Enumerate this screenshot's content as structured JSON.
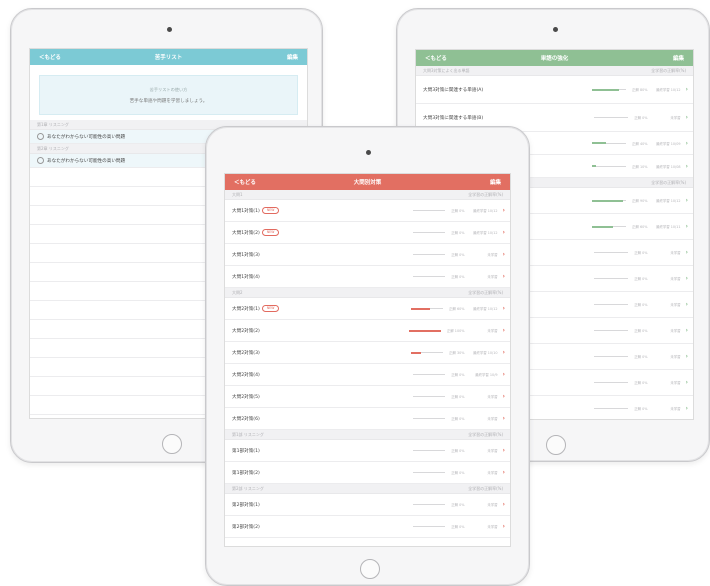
{
  "colors": {
    "blue": "#7ccad5",
    "green": "#8fc094",
    "red": "#e26f62",
    "blue_bg": "#eaf5f9"
  },
  "ipad_left": {
    "nav": {
      "back": "＜もどる",
      "title": "苦手リスト",
      "edit": "編集"
    },
    "notice": {
      "line1": "苦手リストの使い方",
      "line2": "苦手な単語や問題を学習しましょう。"
    },
    "sections": [
      {
        "header": "第1章 リスニング",
        "item": "あなたがわからない可能性の高い問題"
      },
      {
        "header": "第2章 リスニング",
        "item": "あなたがわからない可能性の高い問題"
      }
    ]
  },
  "ipad_right": {
    "nav": {
      "back": "＜もどる",
      "title": "単語の強化",
      "edit": "編集"
    },
    "section1": "大問3対策によく出る単語",
    "section1_right": "全学習の正解率(%)",
    "rows": [
      {
        "label": "大問3対策に関連する単語(A)",
        "meta1": "正解 80%",
        "meta2": "最終学習 10/12",
        "progress": 0.8
      },
      {
        "label": "大問3対策に関連する単語(B)",
        "meta1": "正解 0%",
        "meta2": "未学習",
        "progress": 0.0
      },
      {
        "label": "",
        "meta1": "正解 40%",
        "meta2": "最終学習 10/09",
        "progress": 0.4
      },
      {
        "label": "",
        "meta1": "正解 10%",
        "meta2": "最終学習 10/08",
        "progress": 0.1
      }
    ],
    "section2_right": "全学習の正解率(%)",
    "rows2": [
      {
        "meta1": "正解 90%",
        "meta2": "最終学習 10/12",
        "progress": 0.9
      },
      {
        "meta1": "正解 60%",
        "meta2": "最終学習 10/11",
        "progress": 0.6
      },
      {
        "meta1": "正解 0%",
        "meta2": "未学習",
        "progress": 0.0
      },
      {
        "meta1": "正解 0%",
        "meta2": "未学習",
        "progress": 0.0
      },
      {
        "meta1": "正解 0%",
        "meta2": "未学習",
        "progress": 0.0
      },
      {
        "meta1": "正解 0%",
        "meta2": "未学習",
        "progress": 0.0
      },
      {
        "meta1": "正解 0%",
        "meta2": "未学習",
        "progress": 0.0
      },
      {
        "meta1": "正解 0%",
        "meta2": "未学習",
        "progress": 0.0
      },
      {
        "meta1": "正解 0%",
        "meta2": "未学習",
        "progress": 0.0
      }
    ]
  },
  "ipad_front": {
    "nav": {
      "back": "＜もどる",
      "title": "大問別対策",
      "edit": "編集"
    },
    "groups": [
      {
        "header": "大問1",
        "header_right": "全学習の正解率(%)",
        "rows": [
          {
            "label": "大問1対策(1)",
            "badge": "NEW",
            "meta1": "正解 0%",
            "meta2": "最終学習 10/12",
            "progress": 0.0
          },
          {
            "label": "大問1対策(2)",
            "badge": "NEW",
            "meta1": "正解 0%",
            "meta2": "最終学習 10/12",
            "progress": 0.0
          },
          {
            "label": "大問1対策(3)",
            "badge": "",
            "meta1": "正解 0%",
            "meta2": "未学習",
            "progress": 0.0
          },
          {
            "label": "大問1対策(4)",
            "badge": "",
            "meta1": "正解 0%",
            "meta2": "未学習",
            "progress": 0.0
          }
        ]
      },
      {
        "header": "大問2",
        "header_right": "全学習の正解率(%)",
        "rows": [
          {
            "label": "大問2対策(1)",
            "badge": "NEW",
            "meta1": "正解 60%",
            "meta2": "最終学習 10/12",
            "progress": 0.6
          },
          {
            "label": "大問2対策(2)",
            "badge": "",
            "meta1": "正解 100%",
            "meta2": "未学習",
            "progress": 1.0
          },
          {
            "label": "大問2対策(3)",
            "badge": "",
            "meta1": "正解 30%",
            "meta2": "最終学習 10/10",
            "progress": 0.3
          },
          {
            "label": "大問2対策(4)",
            "badge": "",
            "meta1": "正解 0%",
            "meta2": "最終学習 10/9",
            "progress": 0.0
          },
          {
            "label": "大問2対策(5)",
            "badge": "",
            "meta1": "正解 0%",
            "meta2": "未学習",
            "progress": 0.0
          },
          {
            "label": "大問2対策(6)",
            "badge": "",
            "meta1": "正解 0%",
            "meta2": "未学習",
            "progress": 0.0
          }
        ]
      },
      {
        "header": "第1部 リスニング",
        "header_right": "全学習の正解率(%)",
        "rows": [
          {
            "label": "第1部対策(1)",
            "badge": "",
            "meta1": "正解 0%",
            "meta2": "未学習",
            "progress": 0.0
          },
          {
            "label": "第1部対策(2)",
            "badge": "",
            "meta1": "正解 0%",
            "meta2": "未学習",
            "progress": 0.0
          }
        ]
      },
      {
        "header": "第2部 リスニング",
        "header_right": "全学習の正解率(%)",
        "rows": [
          {
            "label": "第2部対策(1)",
            "badge": "",
            "meta1": "正解 0%",
            "meta2": "未学習",
            "progress": 0.0
          },
          {
            "label": "第2部対策(2)",
            "badge": "",
            "meta1": "正解 0%",
            "meta2": "未学習",
            "progress": 0.0
          }
        ]
      }
    ]
  }
}
